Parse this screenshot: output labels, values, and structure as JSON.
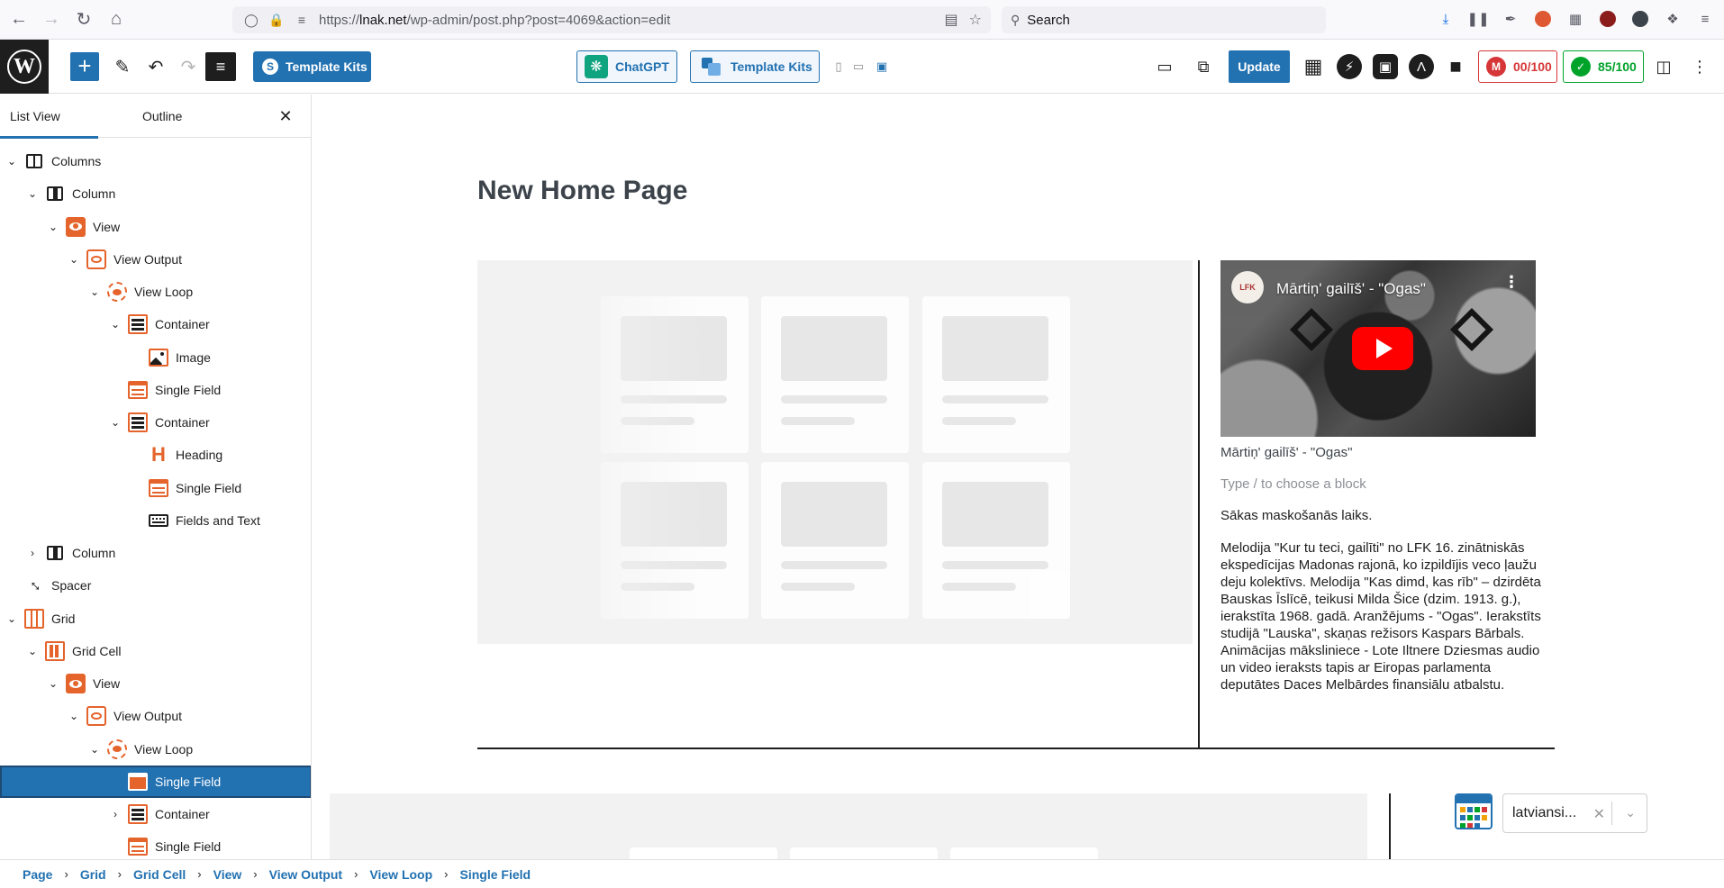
{
  "browser": {
    "url_prefix": "https://",
    "url_domain": "lnak.net",
    "url_path": "/wp-admin/post.php?post=4069&action=edit",
    "search_placeholder": "Search"
  },
  "header": {
    "template_kits_label": "Template Kits",
    "chatgpt_label": "ChatGPT",
    "template_kits2_label": "Template Kits",
    "update_label": "Update",
    "score_red": "00/100",
    "score_green": "85/100"
  },
  "sidebar": {
    "tabs": [
      {
        "label": "List View"
      },
      {
        "label": "Outline"
      }
    ],
    "tree": [
      {
        "label": "Columns",
        "level": 0,
        "expanded": true,
        "icon": "columns-icon"
      },
      {
        "label": "Column",
        "level": 1,
        "expanded": true,
        "icon": "column-icon"
      },
      {
        "label": "View",
        "level": 2,
        "expanded": true,
        "icon": "view-icon"
      },
      {
        "label": "View Output",
        "level": 3,
        "expanded": true,
        "icon": "view-output-icon"
      },
      {
        "label": "View Loop",
        "level": 4,
        "expanded": true,
        "icon": "view-loop-icon"
      },
      {
        "label": "Container",
        "level": 5,
        "expanded": true,
        "icon": "container-icon"
      },
      {
        "label": "Image",
        "level": 6,
        "icon": "image-icon"
      },
      {
        "label": "Single Field",
        "level": 5,
        "icon": "single-field-icon"
      },
      {
        "label": "Container",
        "level": 5,
        "expanded": true,
        "icon": "container-icon"
      },
      {
        "label": "Heading",
        "level": 6,
        "icon": "heading-icon"
      },
      {
        "label": "Single Field",
        "level": 6,
        "icon": "single-field-icon"
      },
      {
        "label": "Fields and Text",
        "level": 6,
        "icon": "fields-and-text-icon"
      },
      {
        "label": "Column",
        "level": 1,
        "expanded": false,
        "icon": "column-icon"
      },
      {
        "label": "Spacer",
        "level": 0,
        "icon": "spacer-icon"
      },
      {
        "label": "Grid",
        "level": 0,
        "expanded": true,
        "icon": "grid-icon"
      },
      {
        "label": "Grid Cell",
        "level": 1,
        "expanded": true,
        "icon": "grid-cell-icon"
      },
      {
        "label": "View",
        "level": 2,
        "expanded": true,
        "icon": "view-icon"
      },
      {
        "label": "View Output",
        "level": 3,
        "expanded": true,
        "icon": "view-output-icon"
      },
      {
        "label": "View Loop",
        "level": 4,
        "expanded": true,
        "icon": "view-loop-icon"
      },
      {
        "label": "Single Field",
        "level": 5,
        "selected": true,
        "icon": "single-field-icon"
      },
      {
        "label": "Container",
        "level": 5,
        "expanded": false,
        "icon": "container-icon"
      },
      {
        "label": "Single Field",
        "level": 5,
        "icon": "single-field-icon"
      }
    ]
  },
  "canvas": {
    "post_title": "New Home Page",
    "video_title": "Mārtiņ' gailīš' - \"Ogas\"",
    "video_channel": "LFK",
    "caption": "Mārtiņ' gailīš' - \"Ogas\"",
    "appender_placeholder": "Type / to choose a block",
    "para1": "Sākas maskošanās laiks.",
    "para2": "Melodija \"Kur tu teci, gailīti\" no LFK 16. zinātniskās ekspedīcijas Madonas rajonā, ko izpildījis veco ļaužu deju kolektīvs. Melodija \"Kas dimd, kas rīb\" – dzirdēta Bauskas Īslīcē, teikusi Milda Šice (dzim. 1913. g.), ierakstīta 1968. gadā. Aranžējums - \"Ogas\". Ierakstīts studijā \"Lauska\", skaņas režisors Kaspars Bārbals. Animācijas māksliniece - Lote Iltnere Dziesmas audio un video ieraksts tapis ar Eiropas parlamenta deputātes Daces Melbārdes finansiālu atbalstu.",
    "lang_select_value": "latviansi..."
  },
  "breadcrumb": [
    "Page",
    "Grid",
    "Grid Cell",
    "View",
    "View Output",
    "View Loop",
    "Single Field"
  ],
  "colors": {
    "accent": "#2271b1",
    "toolset_orange": "#e4642b",
    "score_red": "#d63638",
    "score_green": "#00a32a"
  }
}
